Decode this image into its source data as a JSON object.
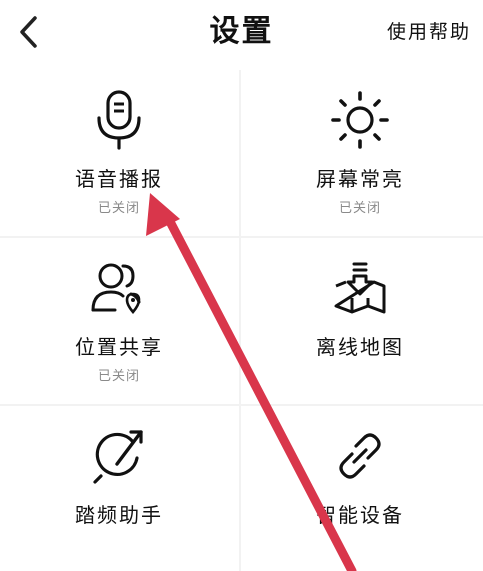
{
  "header": {
    "title": "设置",
    "help_label": "使用帮助",
    "back_icon": "chevron-left-icon"
  },
  "tiles": [
    {
      "label": "语音播报",
      "status": "已关闭",
      "icon": "microphone-icon"
    },
    {
      "label": "屏幕常亮",
      "status": "已关闭",
      "icon": "sun-icon"
    },
    {
      "label": "位置共享",
      "status": "已关闭",
      "icon": "user-location-icon"
    },
    {
      "label": "离线地图",
      "status": "",
      "icon": "map-download-icon"
    },
    {
      "label": "踏频助手",
      "status": "",
      "icon": "cadence-dial-icon"
    },
    {
      "label": "智能设备",
      "status": "",
      "icon": "link-icon"
    }
  ],
  "annotation": {
    "arrow_color": "#d9364b",
    "target": "语音播报"
  }
}
